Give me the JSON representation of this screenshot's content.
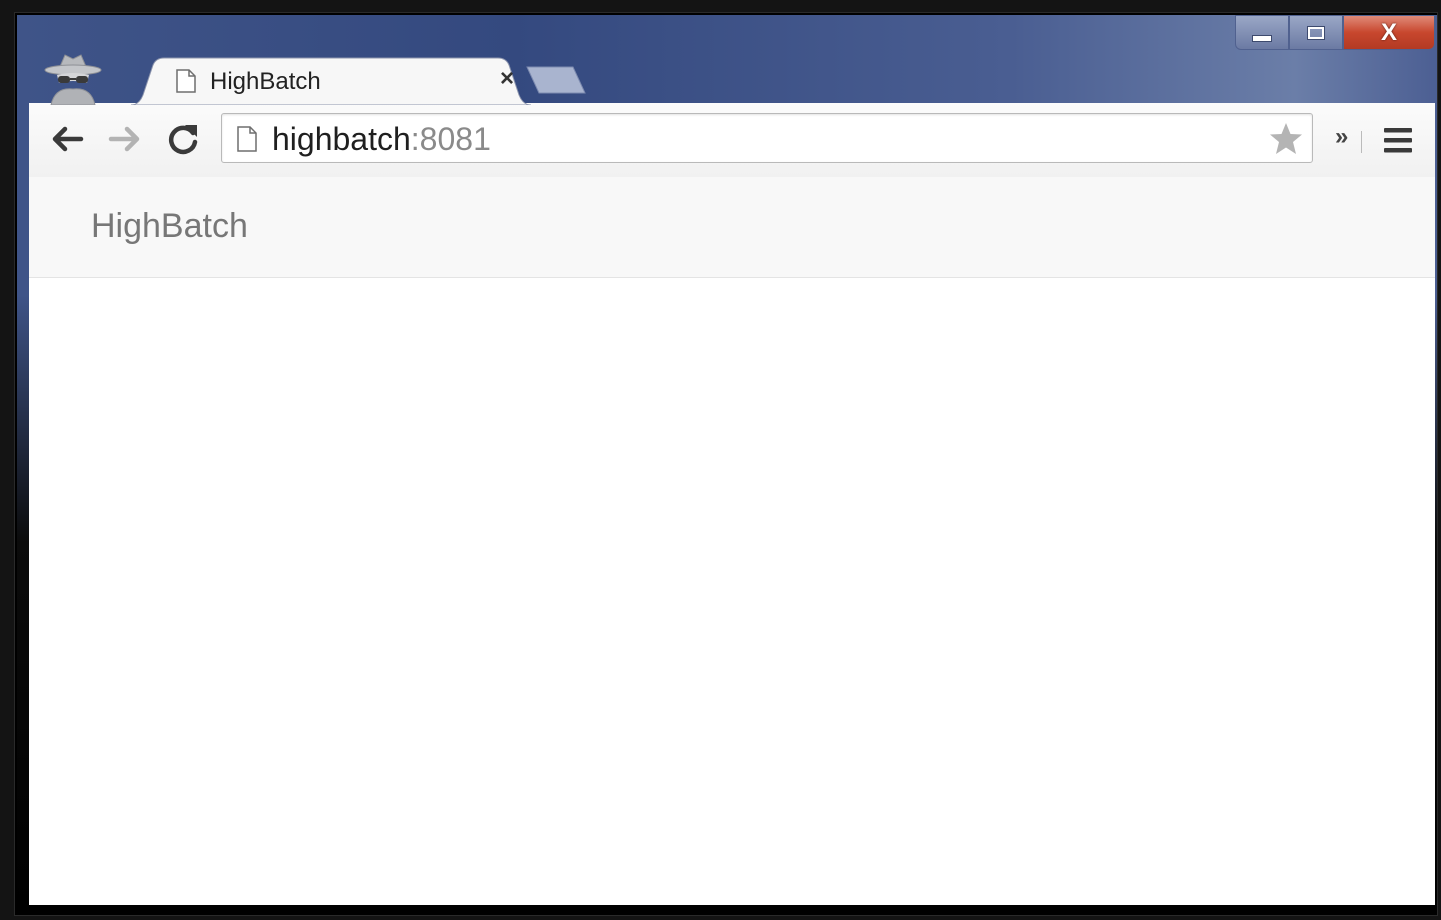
{
  "window": {
    "caption": {
      "minimize_icon": "minimize-icon",
      "maximize_icon": "maximize-icon",
      "close_glyph": "X"
    },
    "incognito_icon": "incognito-icon"
  },
  "tabs": [
    {
      "title": "HighBatch",
      "favicon": "page-icon",
      "close_glyph": "×",
      "active": true
    }
  ],
  "toolbar": {
    "back_icon": "back-arrow-icon",
    "forward_icon": "forward-arrow-icon",
    "reload_icon": "reload-icon",
    "url_host": "highbatch",
    "url_port": ":8081",
    "bookmark_icon": "star-icon",
    "extensions_chevron": "»",
    "menu_icon": "hamburger-menu-icon"
  },
  "page": {
    "navbar": {
      "brand": "HighBatch"
    }
  },
  "colors": {
    "frame": "#3f5488",
    "close_button": "#c8472e",
    "brand_text": "#777777",
    "navbar_bg": "#f8f8f8"
  }
}
